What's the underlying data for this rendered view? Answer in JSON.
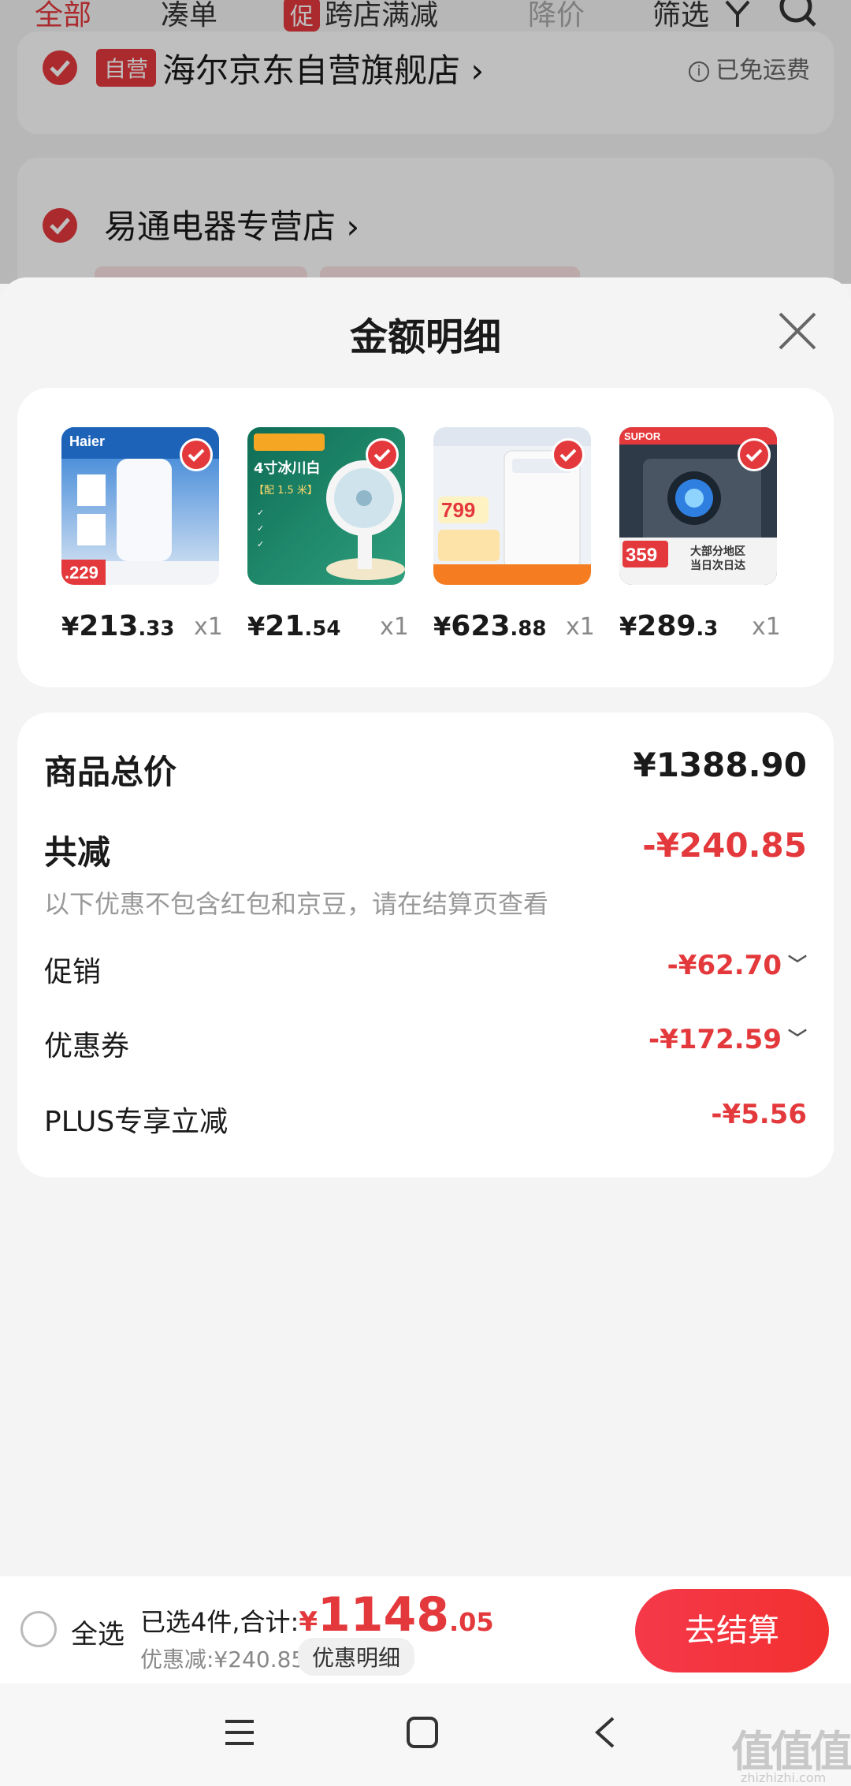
{
  "bg": {
    "tabs": [
      {
        "label": "全部"
      },
      {
        "label": "凑单"
      },
      {
        "badge": "促",
        "label": "跨店满减"
      },
      {
        "label": "降价"
      },
      {
        "label": "筛选"
      }
    ],
    "store1": {
      "tag": "自营",
      "name": "海尔京东自营旗舰店 ›",
      "ship": "已免运费",
      "info_icon": "info-icon"
    },
    "store2": {
      "name": "易通电器专营店 ›"
    }
  },
  "sheet": {
    "title": "金额明细",
    "items": [
      {
        "yen": "¥",
        "int": "213",
        "dec": ".33",
        "qty": "x1",
        "image": "water-purifier",
        "image_text": [
          "Haier",
          ".229"
        ]
      },
      {
        "yen": "¥",
        "int": "21",
        "dec": ".54",
        "qty": "x1",
        "image": "desk-fan",
        "image_text": [
          "4寸冰川白",
          "【配 1.5 米】"
        ]
      },
      {
        "yen": "¥",
        "int": "623",
        "dec": ".88",
        "qty": "x1",
        "image": "washing-machine",
        "image_text": [
          "799"
        ]
      },
      {
        "yen": "¥",
        "int": "289",
        "dec": ".3",
        "qty": "x1",
        "image": "gas-stove",
        "image_text": [
          "SUPOR",
          "359",
          "大部分地区",
          "当日次日达"
        ]
      }
    ],
    "total_label": "商品总价",
    "total_value": "¥1388.90",
    "reduce_label": "共减",
    "reduce_value": "-¥240.85",
    "note": "以下优惠不包含红包和京豆，请在结算页查看",
    "rows": [
      {
        "label": "促销",
        "value": "-¥62.70",
        "chevron": "chevron-down-icon"
      },
      {
        "label": "优惠券",
        "value": "-¥172.59",
        "chevron": "chevron-down-icon"
      },
      {
        "label": "PLUS专享立减",
        "value": "-¥5.56"
      }
    ]
  },
  "bottom": {
    "select_all": "全选",
    "selected_prefix": "已选4件,合计:",
    "total_yen": "¥",
    "total_int": "1148",
    "total_dec": ".05",
    "discount_text": "优惠减:¥240.85",
    "discount_btn": "优惠明细",
    "checkout": "去结算"
  },
  "watermark": {
    "main": "值值值",
    "sub": "zhizhizhi.com"
  },
  "colors": {
    "accent": "#e4393c",
    "background": "#f4f4f4"
  }
}
